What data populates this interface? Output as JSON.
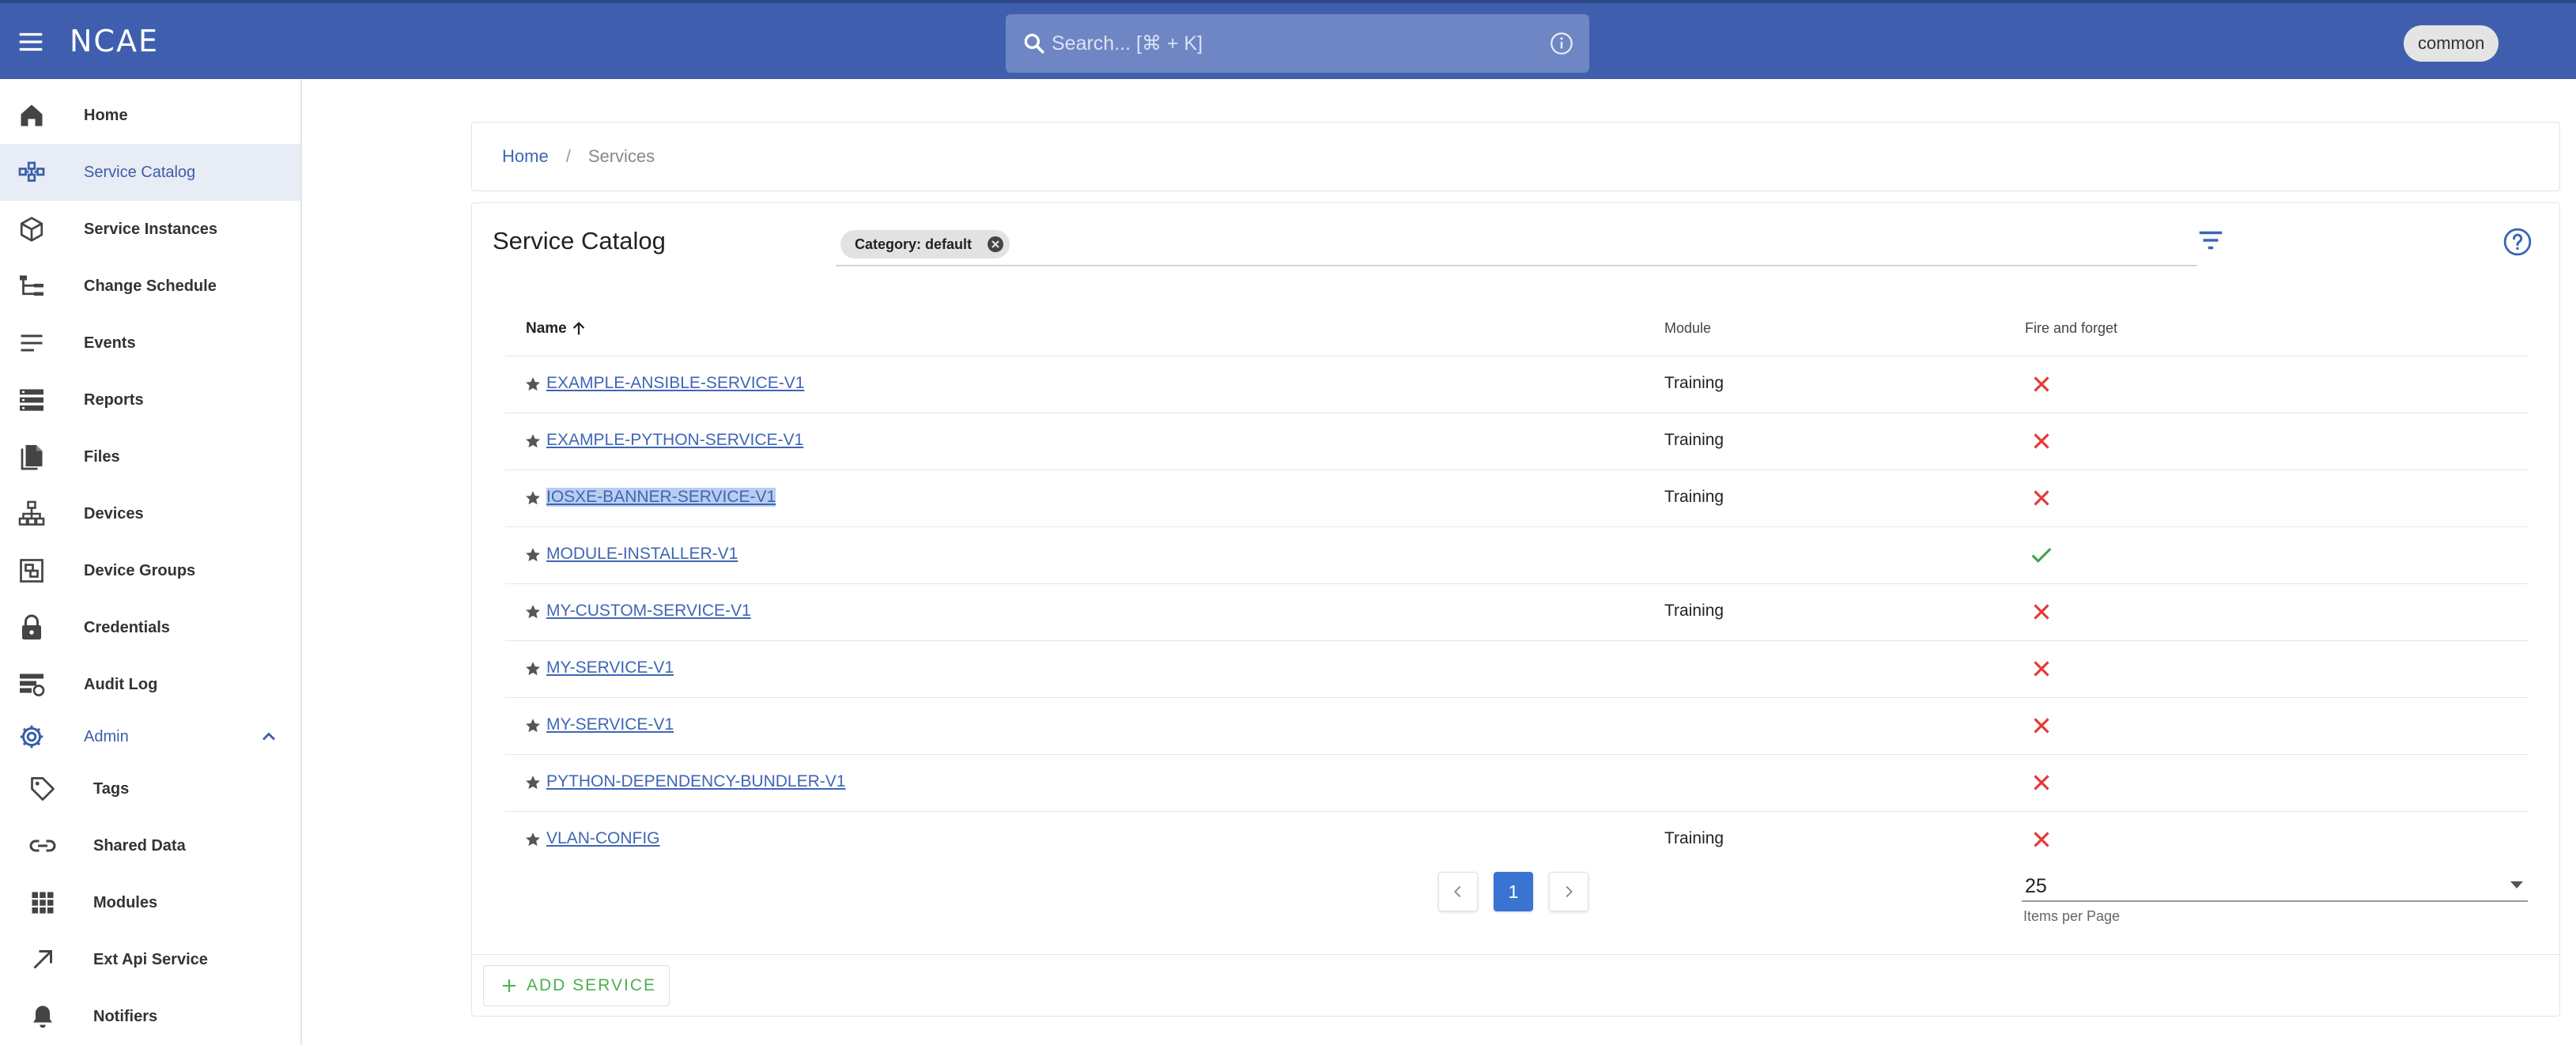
{
  "header": {
    "logo": "NCAE",
    "search_placeholder": "Search... [⌘ + K]",
    "user": "common"
  },
  "sidebar": {
    "items": [
      {
        "label": "Home",
        "icon": "home-icon"
      },
      {
        "label": "Service Catalog",
        "icon": "catalog-icon",
        "active": true
      },
      {
        "label": "Service Instances",
        "icon": "cube-icon"
      },
      {
        "label": "Change Schedule",
        "icon": "schedule-tree-icon"
      },
      {
        "label": "Events",
        "icon": "lines-icon"
      },
      {
        "label": "Reports",
        "icon": "storage-icon"
      },
      {
        "label": "Files",
        "icon": "file-icon"
      },
      {
        "label": "Devices",
        "icon": "network-icon"
      },
      {
        "label": "Device Groups",
        "icon": "device-groups-icon"
      },
      {
        "label": "Credentials",
        "icon": "lock-icon"
      },
      {
        "label": "Audit Log",
        "icon": "audit-log-icon"
      }
    ],
    "admin": {
      "label": "Admin",
      "icon": "gear-icon",
      "expanded": true
    },
    "admin_items": [
      {
        "label": "Tags",
        "icon": "tag-icon"
      },
      {
        "label": "Shared Data",
        "icon": "link-icon"
      },
      {
        "label": "Modules",
        "icon": "grid-icon"
      },
      {
        "label": "Ext Api Service",
        "icon": "arrow-up-right-icon"
      },
      {
        "label": "Notifiers",
        "icon": "bell-icon"
      }
    ]
  },
  "breadcrumb": {
    "home": "Home",
    "separator": "/",
    "current": "Services"
  },
  "catalog": {
    "title": "Service Catalog",
    "filter_chip": "Category: default",
    "columns": {
      "name": "Name",
      "module": "Module",
      "fire_and_forget": "Fire and forget"
    },
    "rows": [
      {
        "name": "EXAMPLE-ANSIBLE-SERVICE-V1",
        "module": "Training",
        "fire_and_forget": false
      },
      {
        "name": "EXAMPLE-PYTHON-SERVICE-V1",
        "module": "Training",
        "fire_and_forget": false
      },
      {
        "name": "IOSXE-BANNER-SERVICE-V1",
        "module": "Training",
        "fire_and_forget": false,
        "selected": true
      },
      {
        "name": "MODULE-INSTALLER-V1",
        "module": "",
        "fire_and_forget": true
      },
      {
        "name": "MY-CUSTOM-SERVICE-V1",
        "module": "Training",
        "fire_and_forget": false
      },
      {
        "name": "MY-SERVICE-V1",
        "module": "",
        "fire_and_forget": false
      },
      {
        "name": "MY-SERVICE-V1",
        "module": "",
        "fire_and_forget": false
      },
      {
        "name": "PYTHON-DEPENDENCY-BUNDLER-V1",
        "module": "",
        "fire_and_forget": false
      },
      {
        "name": "VLAN-CONFIG",
        "module": "Training",
        "fire_and_forget": false
      }
    ],
    "pagination": {
      "current_page": "1",
      "items_per_page": "25",
      "items_per_page_label": "Items per Page"
    },
    "add_button": "ADD SERVICE"
  },
  "colors": {
    "header": "#3f5fae",
    "link": "#3f66b5",
    "error": "#e53935",
    "success": "#43a047",
    "add": "#4caf50"
  }
}
